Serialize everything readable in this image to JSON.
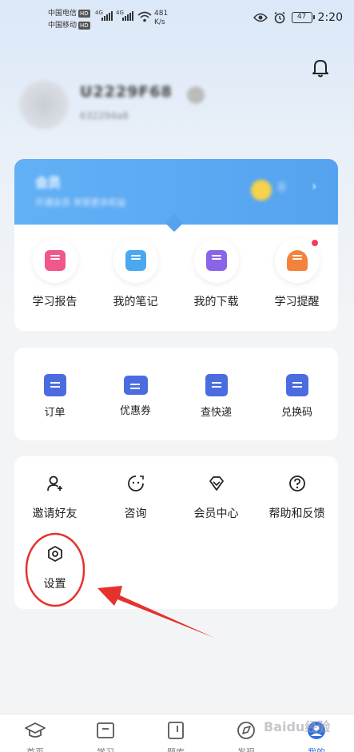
{
  "status_bar": {
    "carrier1": "中国电信",
    "carrier2": "中国移动",
    "hd": "HD",
    "network": "4G",
    "speed_value": "481",
    "speed_unit": "K/s",
    "battery": "47",
    "time": "2:20"
  },
  "profile": {
    "username": "U2229F68",
    "user_id": "632294a8"
  },
  "vip": {
    "title": "会员",
    "subtitle": "开通会员 享受更多权益",
    "count": "0",
    "chevron": "›"
  },
  "study_tools": [
    {
      "label": "学习报告",
      "icon": "report-icon",
      "color": "#f0578a",
      "badge": false
    },
    {
      "label": "我的笔记",
      "icon": "notes-icon",
      "color": "#4aa8f0",
      "badge": false
    },
    {
      "label": "我的下载",
      "icon": "download-icon",
      "color": "#8a64e8",
      "badge": false
    },
    {
      "label": "学习提醒",
      "icon": "reminder-icon",
      "color": "#f5823c",
      "badge": true
    }
  ],
  "services": [
    {
      "label": "订单",
      "icon": "order-icon"
    },
    {
      "label": "优惠券",
      "icon": "coupon-icon"
    },
    {
      "label": "查快递",
      "icon": "express-icon"
    },
    {
      "label": "兑换码",
      "icon": "redeem-code-icon"
    }
  ],
  "more": [
    {
      "label": "邀请好友",
      "icon": "invite-friend-icon"
    },
    {
      "label": "咨询",
      "icon": "consult-icon"
    },
    {
      "label": "会员中心",
      "icon": "member-center-icon"
    },
    {
      "label": "帮助和反馈",
      "icon": "help-icon"
    },
    {
      "label": "设置",
      "icon": "settings-icon"
    }
  ],
  "tabbar": [
    {
      "label": "首页",
      "icon": "home-cap-icon",
      "active": false
    },
    {
      "label": "学习",
      "icon": "study-book-icon",
      "active": false
    },
    {
      "label": "题库",
      "icon": "question-bank-icon",
      "active": false
    },
    {
      "label": "发现",
      "icon": "discover-icon",
      "active": false
    },
    {
      "label": "我的",
      "icon": "profile-icon",
      "active": true
    }
  ],
  "watermark": "Baidu经验",
  "colors": {
    "vip_card": "#58a6f2",
    "service_icon": "#4b6ce0",
    "annotation_red": "#e5322d",
    "active_tab": "#2c6fe0"
  }
}
